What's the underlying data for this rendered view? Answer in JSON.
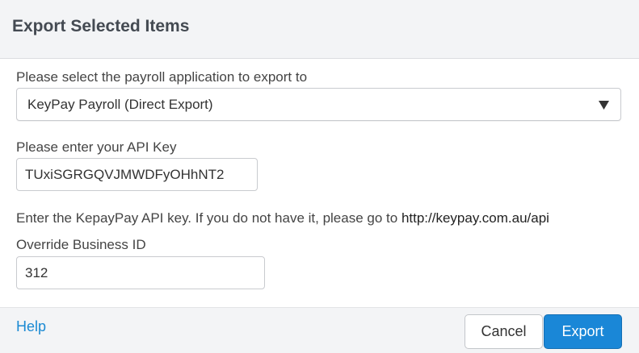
{
  "dialog": {
    "title": "Export Selected Items"
  },
  "form": {
    "app_label": "Please select the payroll application to export to",
    "app_selected": "KeyPay Payroll (Direct Export)",
    "api_key_label": "Please enter your API Key",
    "api_key_value": "TUxiSGRGQVJMWDFyOHhNT2",
    "hint_text": "Enter the KepayPay API key. If you do not have it, please go to ",
    "hint_link": "http://keypay.com.au/api",
    "override_label": "Override Business ID",
    "override_value": "312"
  },
  "footer": {
    "help_label": "Help",
    "cancel_label": "Cancel",
    "export_label": "Export"
  },
  "colors": {
    "header_bg": "#f3f4f6",
    "link": "#1b8ad3",
    "primary_button": "#1a87d7"
  },
  "icons": {
    "select_arrow": "triangle-down-icon"
  }
}
